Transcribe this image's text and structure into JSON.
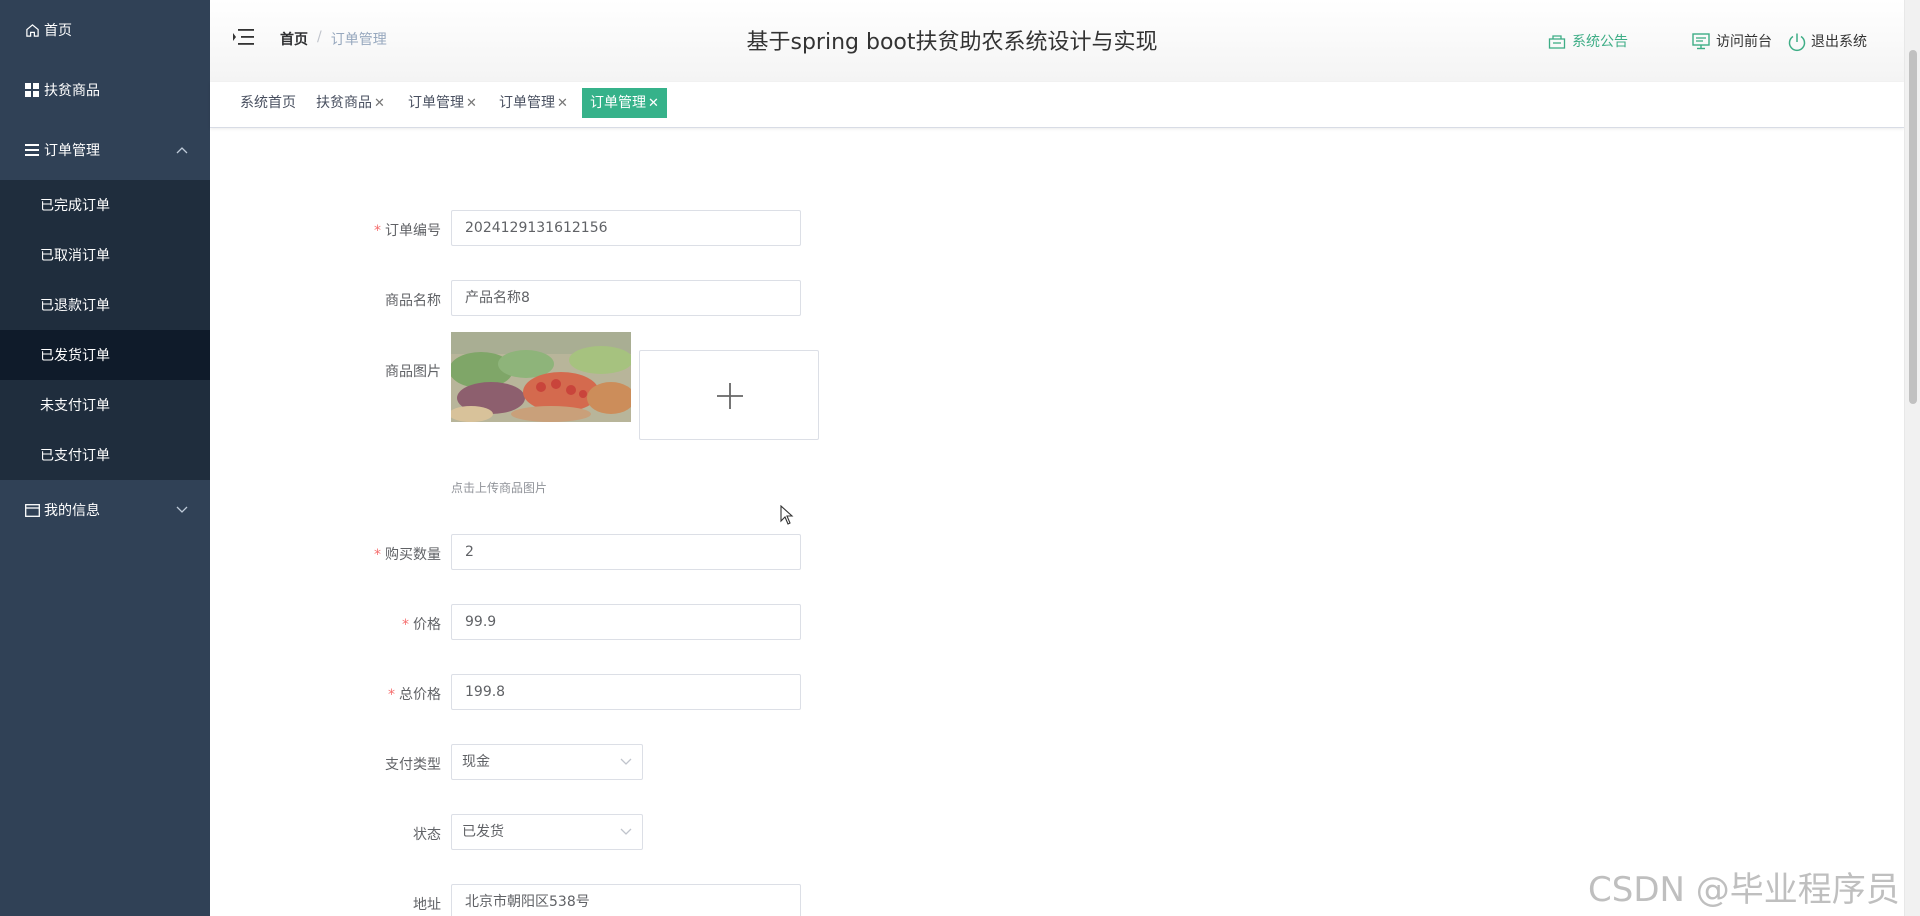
{
  "sidebar": {
    "items": [
      {
        "label": "首页",
        "icon": "home-icon"
      },
      {
        "label": "扶贫商品",
        "icon": "grid-icon"
      },
      {
        "label": "订单管理",
        "icon": "list-icon",
        "expanded": true
      }
    ],
    "submenu": [
      {
        "label": "已完成订单"
      },
      {
        "label": "已取消订单"
      },
      {
        "label": "已退款订单"
      },
      {
        "label": "已发货订单",
        "active": true
      },
      {
        "label": "未支付订单"
      },
      {
        "label": "已支付订单"
      }
    ],
    "my_info": {
      "label": "我的信息",
      "icon": "card-icon"
    }
  },
  "header": {
    "breadcrumb": {
      "home": "首页",
      "current": "订单管理"
    },
    "title": "基于spring boot扶贫助农系统设计与实现",
    "notice": "系统公告",
    "visit": "访问前台",
    "logout": "退出系统"
  },
  "tags": [
    {
      "label": "系统首页"
    },
    {
      "label": "扶贫商品",
      "close": "✕"
    },
    {
      "label": "订单管理",
      "close": "✕"
    },
    {
      "label": "订单管理",
      "close": "✕"
    },
    {
      "label": "订单管理",
      "close": "✕",
      "active": true
    }
  ],
  "form": {
    "order_no": {
      "label": "订单编号",
      "value": "2024129131612156",
      "required": true
    },
    "product_name": {
      "label": "商品名称",
      "value": "产品名称8"
    },
    "product_image": {
      "label": "商品图片",
      "tip": "点击上传商品图片"
    },
    "quantity": {
      "label": "购买数量",
      "value": "2",
      "required": true
    },
    "price": {
      "label": "价格",
      "value": "99.9",
      "required": true
    },
    "total": {
      "label": "总价格",
      "value": "199.8",
      "required": true
    },
    "pay_type": {
      "label": "支付类型",
      "value": "现金"
    },
    "status": {
      "label": "状态",
      "value": "已发货"
    },
    "address": {
      "label": "地址",
      "value": "北京市朝阳区538号"
    }
  },
  "required_mark": "*",
  "watermark": "CSDN @毕业程序员",
  "colors": {
    "sidebar": "#304156",
    "accent": "#36b28a",
    "required": "#f56c6c"
  }
}
